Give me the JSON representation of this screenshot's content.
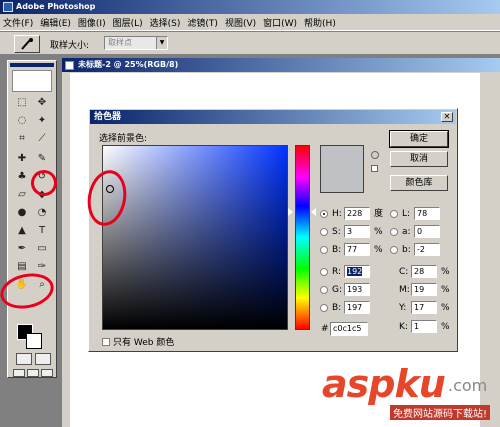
{
  "app": {
    "title": "Adobe Photoshop"
  },
  "menu": [
    "文件(F)",
    "编辑(E)",
    "图像(I)",
    "图层(L)",
    "选择(S)",
    "滤镜(T)",
    "视图(V)",
    "窗口(W)",
    "帮助(H)"
  ],
  "options": {
    "sample_label": "取样大小:",
    "sample_value": "取样点"
  },
  "document": {
    "title": "未标题-2 @ 25%(RGB/8)"
  },
  "dialog": {
    "title": "拾色器",
    "caption": "选择前景色:",
    "buttons": {
      "ok": "确定",
      "cancel": "取消",
      "libraries": "颜色库"
    },
    "fields": {
      "H": {
        "label": "H:",
        "value": "228",
        "unit": "度"
      },
      "S": {
        "label": "S:",
        "value": "3",
        "unit": "%"
      },
      "Bv": {
        "label": "B:",
        "value": "77",
        "unit": "%"
      },
      "R": {
        "label": "R:",
        "value": "192"
      },
      "G": {
        "label": "G:",
        "value": "193"
      },
      "B": {
        "label": "B:",
        "value": "197"
      },
      "L": {
        "label": "L:",
        "value": "78"
      },
      "a": {
        "label": "a:",
        "value": "0"
      },
      "b": {
        "label": "b:",
        "value": "-2"
      },
      "C": {
        "label": "C:",
        "value": "28",
        "unit": "%"
      },
      "M": {
        "label": "M:",
        "value": "19",
        "unit": "%"
      },
      "Y": {
        "label": "Y:",
        "value": "17",
        "unit": "%"
      },
      "K": {
        "label": "K:",
        "value": "1",
        "unit": "%"
      }
    },
    "hex_label": "#",
    "hex": "c0c1c5",
    "web_only": "只有 Web 颜色",
    "selected_color": "#c0c1c5"
  },
  "watermark": {
    "brand": "aspku",
    "tld": ".com",
    "tagline": "免费网站源码下载站!"
  }
}
